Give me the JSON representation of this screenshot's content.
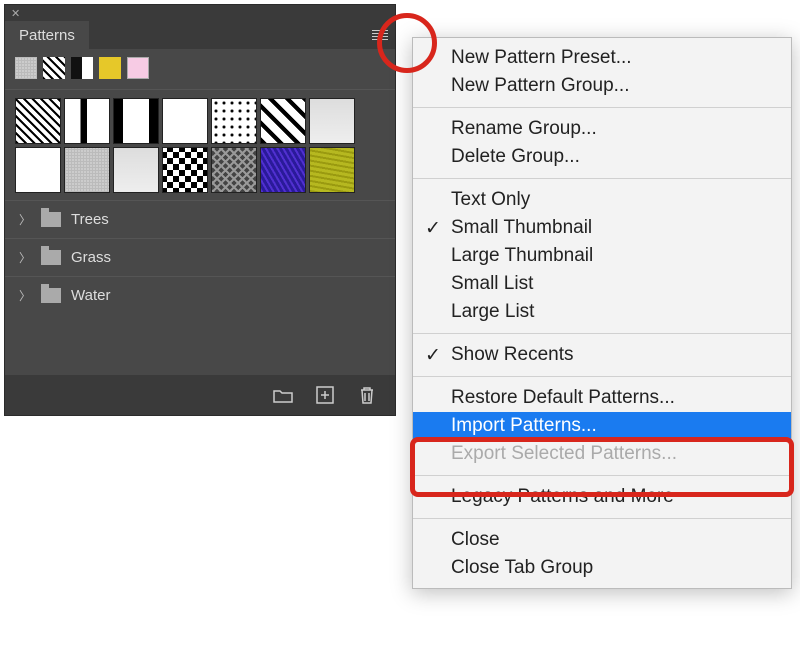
{
  "panel": {
    "tab_title": "Patterns",
    "folders": [
      "Trees",
      "Grass",
      "Water"
    ]
  },
  "menu": {
    "items": [
      {
        "label": "New Pattern Preset..."
      },
      {
        "label": "New Pattern Group..."
      },
      {
        "sep": true
      },
      {
        "label": "Rename Group..."
      },
      {
        "label": "Delete Group..."
      },
      {
        "sep": true
      },
      {
        "label": "Text Only"
      },
      {
        "label": "Small Thumbnail",
        "checked": true
      },
      {
        "label": "Large Thumbnail"
      },
      {
        "label": "Small List"
      },
      {
        "label": "Large List"
      },
      {
        "sep": true
      },
      {
        "label": "Show Recents",
        "checked": true
      },
      {
        "sep": true
      },
      {
        "label": "Restore Default Patterns..."
      },
      {
        "label": "Import Patterns...",
        "highlighted": true
      },
      {
        "label": "Export Selected Patterns...",
        "disabled": true
      },
      {
        "sep": true
      },
      {
        "label": "Legacy Patterns and More"
      },
      {
        "sep": true
      },
      {
        "label": "Close"
      },
      {
        "label": "Close Tab Group"
      }
    ]
  }
}
